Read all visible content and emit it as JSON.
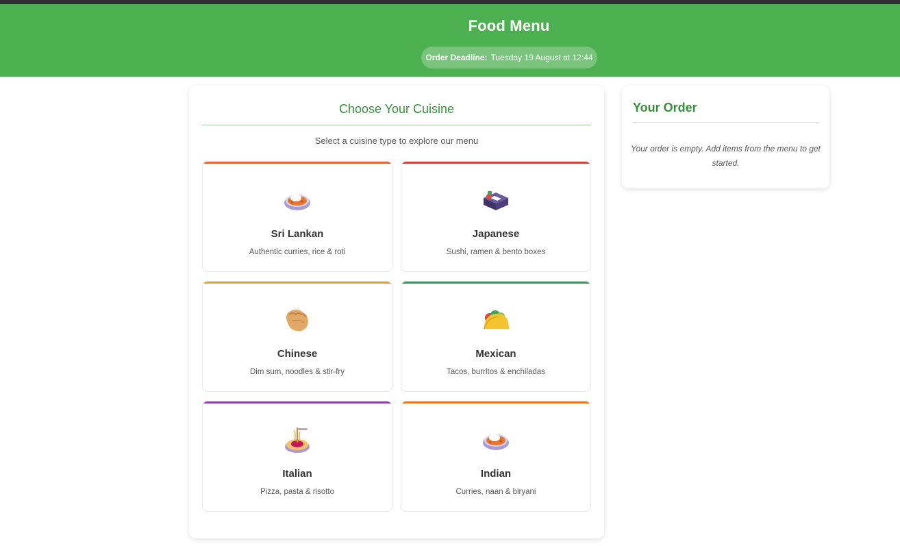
{
  "header": {
    "title": "Food Menu",
    "deadline_label": "Order Deadline:",
    "deadline_value": "Tuesday 19 August at 12:44",
    "color": "#4caf50"
  },
  "menu": {
    "title": "Choose Your Cuisine",
    "subtitle": "Select a cuisine type to explore our menu",
    "cuisines": [
      {
        "name": "Sri Lankan",
        "description": "Authentic curries, rice & roti",
        "icon": "curry-rice-icon",
        "accent": "#e06a3c"
      },
      {
        "name": "Japanese",
        "description": "Sushi, ramen & bento boxes",
        "icon": "bento-box-icon",
        "accent": "#d0463c"
      },
      {
        "name": "Chinese",
        "description": "Dim sum, noodles & stir-fry",
        "icon": "dumpling-icon",
        "accent": "#e6a428"
      },
      {
        "name": "Mexican",
        "description": "Tacos, burritos & enchiladas",
        "icon": "taco-icon",
        "accent": "#2e9a5b"
      },
      {
        "name": "Italian",
        "description": "Pizza, pasta & risotto",
        "icon": "spaghetti-icon",
        "accent": "#8e44ad"
      },
      {
        "name": "Indian",
        "description": "Curries, naan & biryani",
        "icon": "curry-rice-icon",
        "accent": "#e07b1a"
      }
    ]
  },
  "order": {
    "title": "Your Order",
    "empty_text": "Your order is empty. Add items from the menu to get started."
  }
}
